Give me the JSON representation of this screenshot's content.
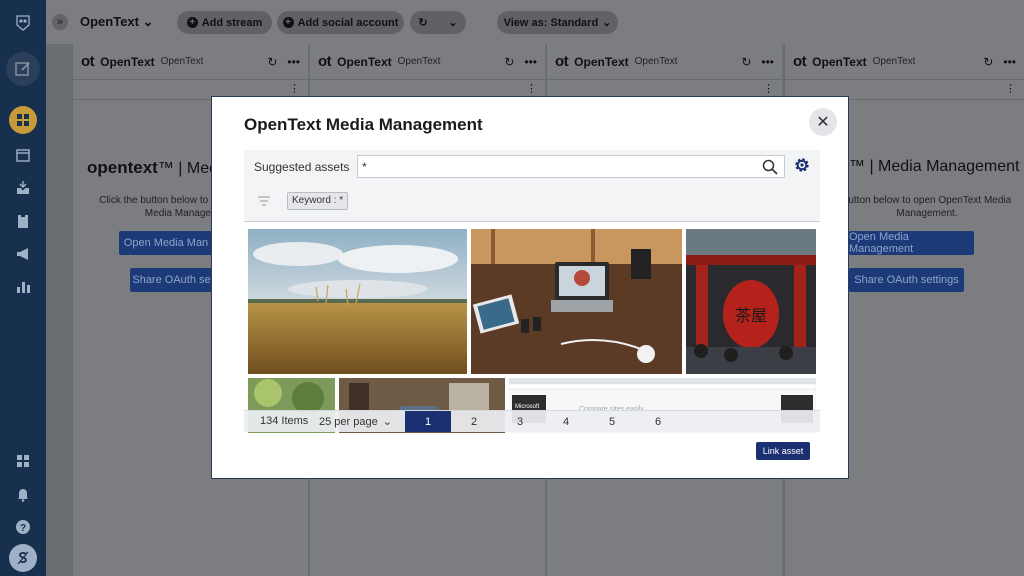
{
  "topbar": {
    "expand_glyph": "»",
    "org_name": "OpenText",
    "add_stream": "Add stream",
    "add_social": "Add social account",
    "refresh_glyph": "↻",
    "view_as": "View as: Standard"
  },
  "stream": {
    "title": "OpenText",
    "subtitle": "OpenText",
    "ot_mark": "ot",
    "brand_word": "opentext",
    "brand_tm": "™",
    "brand_product_left": "| Media",
    "brand_product_right": "| Media Management",
    "intro_left": "Click the button below to open OpenText Media Management",
    "intro_right": "button below to open OpenText Media Management.",
    "open_button_left": "Open Media Man",
    "open_button_right": "Open Media Management",
    "share_button_left": "Share OAuth se",
    "share_button_right": "Share OAuth settings"
  },
  "modal": {
    "title": "OpenText Media Management",
    "close_glyph": "✕",
    "search": {
      "label": "Suggested assets",
      "value": "*"
    },
    "filter_chip": "Keyword : *",
    "tile_text": {
      "lantern": "茶屋",
      "screenshot_heading": "Microsoft",
      "screenshot_caption": "Compare sites easily"
    },
    "pager": {
      "count": "134 Items",
      "per_page": "25 per page",
      "pages": [
        "1",
        "2",
        "3",
        "4",
        "5",
        "6"
      ],
      "active_page": "1"
    },
    "link_button": "Link asset"
  },
  "colors": {
    "brand_navy": "#1b2f73",
    "rail": "#16304d",
    "overlay": "#7b7d80"
  }
}
